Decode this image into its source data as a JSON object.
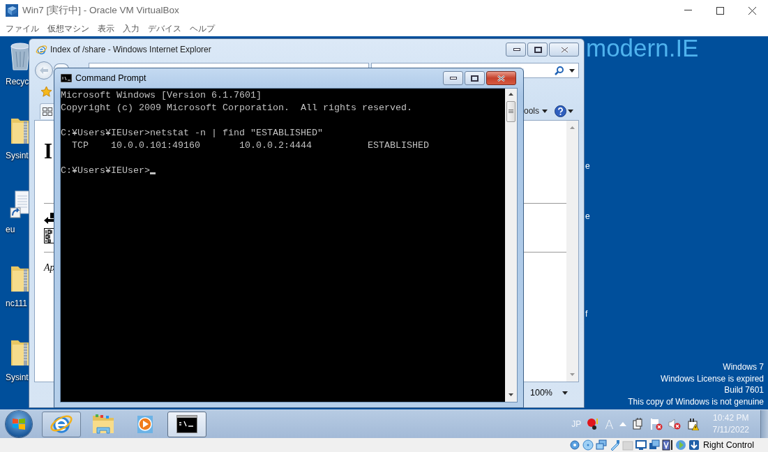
{
  "host_window": {
    "title": "Win7 [実行中] - Oracle VM VirtualBox",
    "menu": [
      "ファイル",
      "仮想マシン",
      "表示",
      "入力",
      "デバイス",
      "ヘルプ"
    ]
  },
  "desktop": {
    "icons": [
      {
        "label": "Recyc",
        "kind": "recycle"
      },
      {
        "label": "Sysint",
        "kind": "zip"
      },
      {
        "label": "eu",
        "kind": "shortcut"
      },
      {
        "label": "nc111",
        "kind": "zip"
      },
      {
        "label": "Sysint",
        "kind": "zip"
      }
    ],
    "logo": "modern.IE",
    "fragments": [
      "e",
      "e",
      "f"
    ],
    "notice": [
      "Windows 7",
      "Windows License is expired",
      "Build 7601",
      "This copy of Windows is not genuine"
    ]
  },
  "browser": {
    "title": "Index of /share - Windows Internet Explorer",
    "tools_fragment": "ools",
    "heading_fragment": "I",
    "footer_fragment": "Ap",
    "zoom": "100%"
  },
  "console": {
    "title": "Command Prompt",
    "blocks": [
      [
        "Microsoft Windows [Version 6.1.7601]",
        "Copyright (c) 2009 Microsoft Corporation.  All rights reserved."
      ],
      [
        "C:¥Users¥IEUser>netstat -n | find \"ESTABLISHED\"",
        "  TCP    10.0.0.101:49160       10.0.0.2:4444          ESTABLISHED"
      ],
      [
        "C:¥Users¥IEUser>"
      ]
    ]
  },
  "taskbar": {
    "items": [
      {
        "kind": "browser",
        "running": true,
        "selected": false
      },
      {
        "kind": "folder",
        "running": false,
        "selected": false
      },
      {
        "kind": "media",
        "running": false,
        "selected": false
      },
      {
        "kind": "console",
        "running": true,
        "selected": true
      }
    ],
    "tray": {
      "language": "JP",
      "ime_mode": "A",
      "time": "10:42 PM",
      "date": "7/11/2022"
    }
  },
  "status_bar": {
    "host_key": "Right Control"
  }
}
